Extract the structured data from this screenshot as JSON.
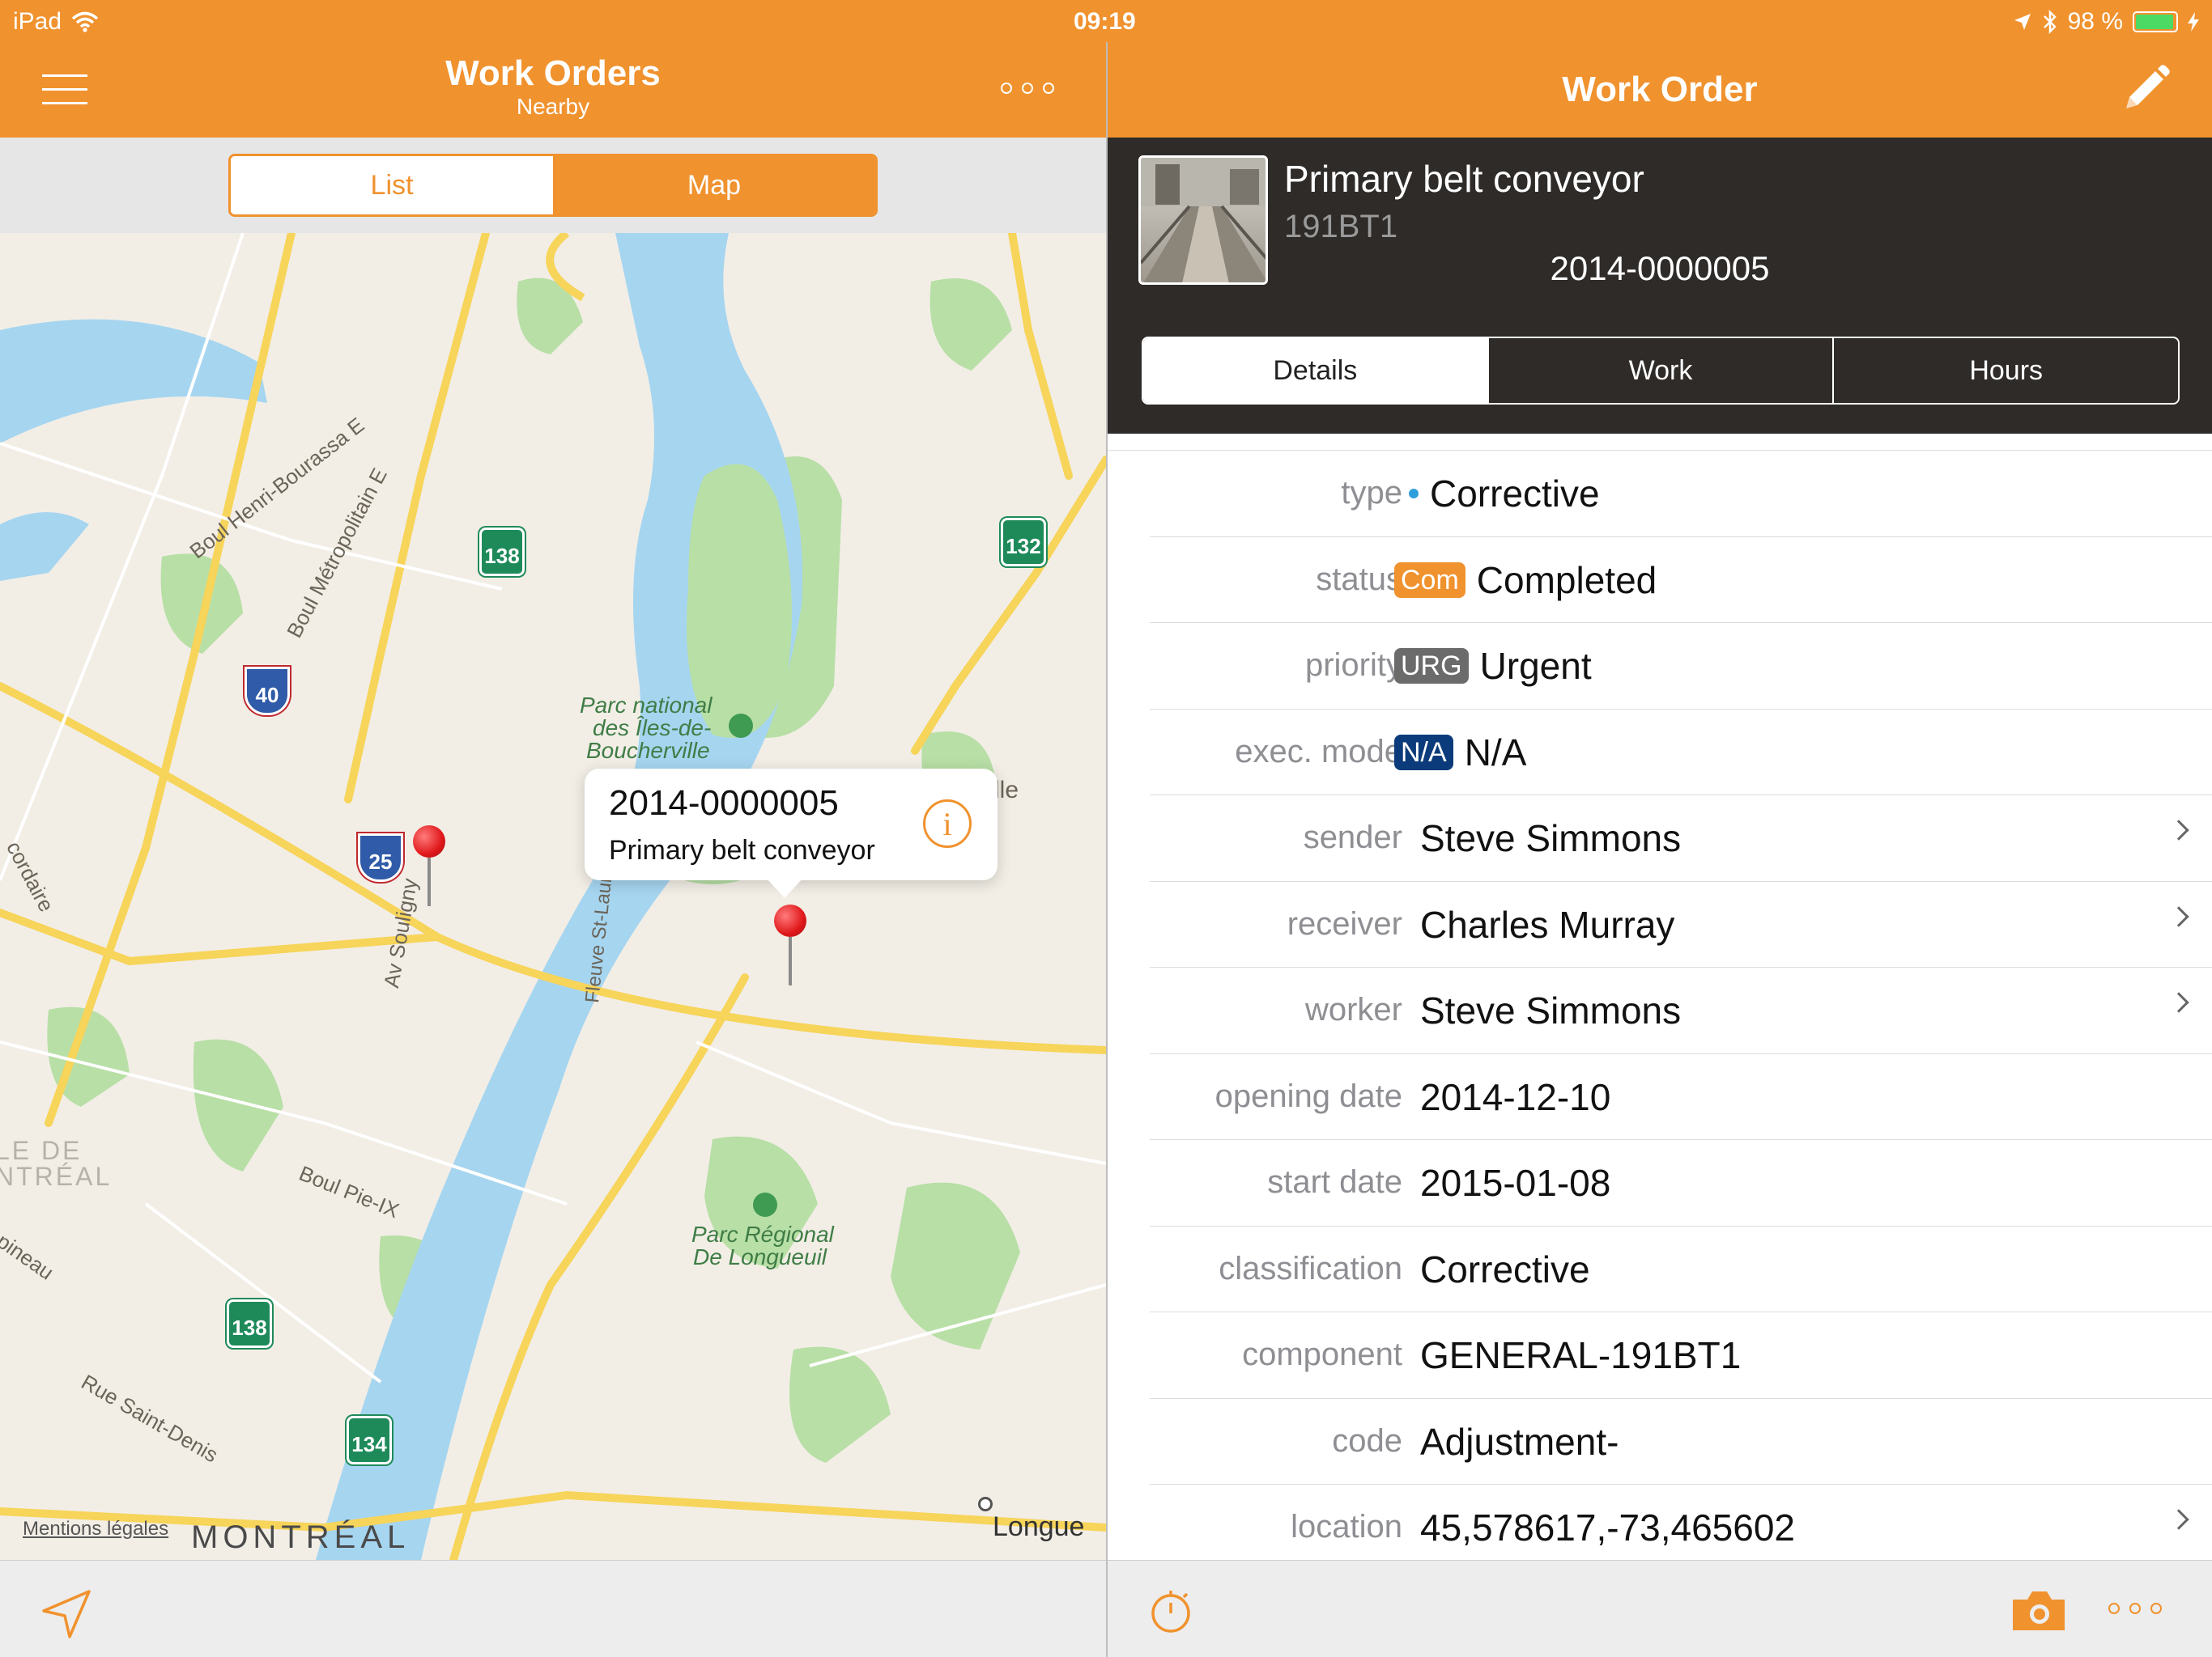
{
  "status_bar": {
    "device": "iPad",
    "time": "09:19",
    "battery": "98 %"
  },
  "left_pane": {
    "title": "Work Orders",
    "subtitle": "Nearby",
    "segments": {
      "list": "List",
      "map": "Map"
    },
    "map": {
      "labels": {
        "henri_bourassa": "Boul Henri-Bourassa E",
        "metropolitain": "Boul Métropolitain E",
        "park_iles": "Parc national des Îles-de-Boucherville",
        "park_iles_line1": "Parc national",
        "park_iles_line2": "des Îles-de-",
        "park_iles_line3": "Boucherville",
        "boucherville_suffix": "lle",
        "souligny": "Av Souligny",
        "fleuve": "Fleuve St-Laurent",
        "pie_ix": "Boul Pie-IX",
        "st_denis": "Rue Saint-Denis",
        "cordaire": "cordaire",
        "pineau": "pineau",
        "ile_de": "LE DE",
        "ntreal": "NTRÉAL",
        "longueuil_park_line1": "Parc Régional",
        "longueuil_park_line2": "De Longueuil",
        "montreal": "MONTRÉAL",
        "longue": "Longue",
        "legal": "Mentions légales"
      },
      "shields": [
        "138",
        "132",
        "40",
        "25",
        "138",
        "134"
      ],
      "callout": {
        "id": "2014-0000005",
        "name": "Primary belt conveyor"
      }
    }
  },
  "right_pane": {
    "title": "Work Order",
    "header": {
      "name": "Primary belt conveyor",
      "code": "191BT1",
      "number": "2014-0000005"
    },
    "tabs": [
      "Details",
      "Work",
      "Hours"
    ],
    "rows": [
      {
        "label": "type",
        "value": "Corrective"
      },
      {
        "label": "status",
        "badge": "Com",
        "value": "Completed"
      },
      {
        "label": "priority",
        "badge": "URG",
        "value": "Urgent"
      },
      {
        "label": "exec. mode",
        "badge": "N/A",
        "value": "N/A"
      },
      {
        "label": "sender",
        "value": "Steve Simmons"
      },
      {
        "label": "receiver",
        "value": "Charles Murray"
      },
      {
        "label": "worker",
        "value": "Steve Simmons"
      },
      {
        "label": "opening date",
        "value": "2014-12-10"
      },
      {
        "label": "start date",
        "value": "2015-01-08"
      },
      {
        "label": "classification",
        "value": "Corrective"
      },
      {
        "label": "component",
        "value": "GENERAL-191BT1"
      },
      {
        "label": "code",
        "value": "Adjustment-"
      },
      {
        "label": "location",
        "value": "45,578617,-73,465602"
      }
    ]
  },
  "colors": {
    "accent": "#F0922E",
    "header_dark": "#2E2B28",
    "badge_status": "#F0922E",
    "badge_priority": "#6B6B6B",
    "badge_exec": "#0B3B7A",
    "type_dot": "#2E9EDB",
    "water": "#A6D5F0",
    "park": "#B8DFA6",
    "road": "#F7D45A"
  }
}
